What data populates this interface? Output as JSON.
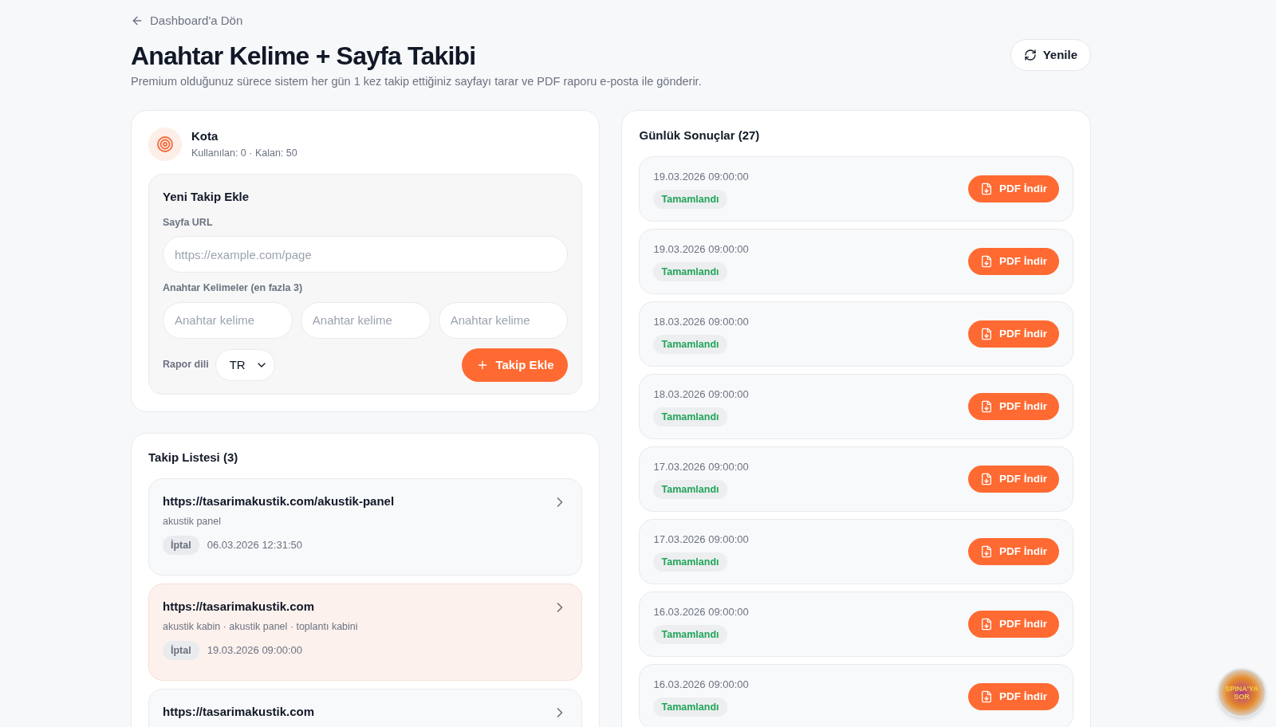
{
  "back_link": "Dashboard'a Dön",
  "title": "Anahtar Kelime + Sayfa Takibi",
  "subtitle": "Premium olduğunuz sürece sistem her gün 1 kez takip ettiğiniz sayfayı tarar ve PDF raporu e-posta ile gönderir.",
  "refresh_button": "Yenile",
  "quota": {
    "title": "Kota",
    "detail": "Kullanılan: 0 · Kalan: 50"
  },
  "new_tracking": {
    "title": "Yeni Takip Ekle",
    "url_label": "Sayfa URL",
    "url_placeholder": "https://example.com/page",
    "keywords_label": "Anahtar Kelimeler (en fazla 3)",
    "keyword_fields": [
      {
        "placeholder": "Anahtar kelime"
      },
      {
        "placeholder": "Anahtar kelime"
      },
      {
        "placeholder": "Anahtar kelime"
      }
    ],
    "language_label": "Rapor dili",
    "language": "TR",
    "add_button": "Takip Ekle"
  },
  "tracking_list": {
    "title": "Takip Listesi (3)",
    "items": [
      {
        "url": "https://tasarimakustik.com/akustik-panel",
        "keywords": "akustik panel",
        "status": "İptal",
        "date": "06.03.2026 12:31:50",
        "selected": false
      },
      {
        "url": "https://tasarimakustik.com",
        "keywords": "akustik kabin · akustik panel · toplantı kabini",
        "status": "İptal",
        "date": "19.03.2026 09:00:00",
        "selected": true
      },
      {
        "url": "https://tasarimakustik.com",
        "selected": false
      }
    ]
  },
  "daily_results": {
    "title": "Günlük Sonuçlar (27)",
    "items": [
      {
        "date": "19.03.2026 09:00:00",
        "status": "Tamamlandı",
        "button": "PDF İndir"
      },
      {
        "date": "19.03.2026 09:00:00",
        "status": "Tamamlandı",
        "button": "PDF İndir"
      },
      {
        "date": "18.03.2026 09:00:00",
        "status": "Tamamlandı",
        "button": "PDF İndir"
      },
      {
        "date": "18.03.2026 09:00:00",
        "status": "Tamamlandı",
        "button": "PDF İndir"
      },
      {
        "date": "17.03.2026 09:00:00",
        "status": "Tamamlandı",
        "button": "PDF İndir"
      },
      {
        "date": "17.03.2026 09:00:00",
        "status": "Tamamlandı",
        "button": "PDF İndir"
      },
      {
        "date": "16.03.2026 09:00:00",
        "status": "Tamamlandı",
        "button": "PDF İndir"
      },
      {
        "date": "16.03.2026 09:00:00",
        "status": "Tamamlandı",
        "button": "PDF İndir"
      }
    ]
  },
  "assistant_button": "SPINA'YA SOR"
}
